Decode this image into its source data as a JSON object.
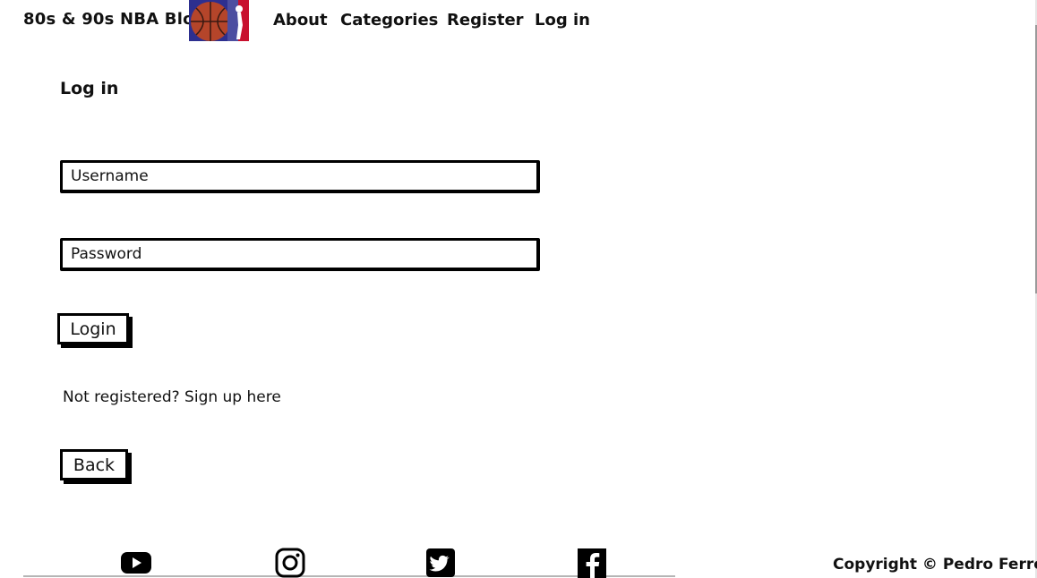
{
  "nav": {
    "brand": "80s & 90s NBA Blog",
    "logo_icon": "nba-basketball-logo-icon",
    "links": [
      "About",
      "Categories",
      "Register",
      "Log in"
    ]
  },
  "main": {
    "heading": "Log in",
    "username_placeholder": "Username",
    "password_placeholder": "Password",
    "login_button": "Login",
    "signup_text": "Not registered? Sign up here",
    "back_button": "Back"
  },
  "footer": {
    "social_icons": [
      "youtube-icon",
      "instagram-icon",
      "twitter-icon",
      "facebook-icon"
    ],
    "copyright": "Copyright © Pedro Ferreira"
  },
  "colors": {
    "text": "#111111",
    "background": "#ffffff",
    "logo_blue": "#2d2f8f",
    "logo_red": "#c8102e"
  }
}
